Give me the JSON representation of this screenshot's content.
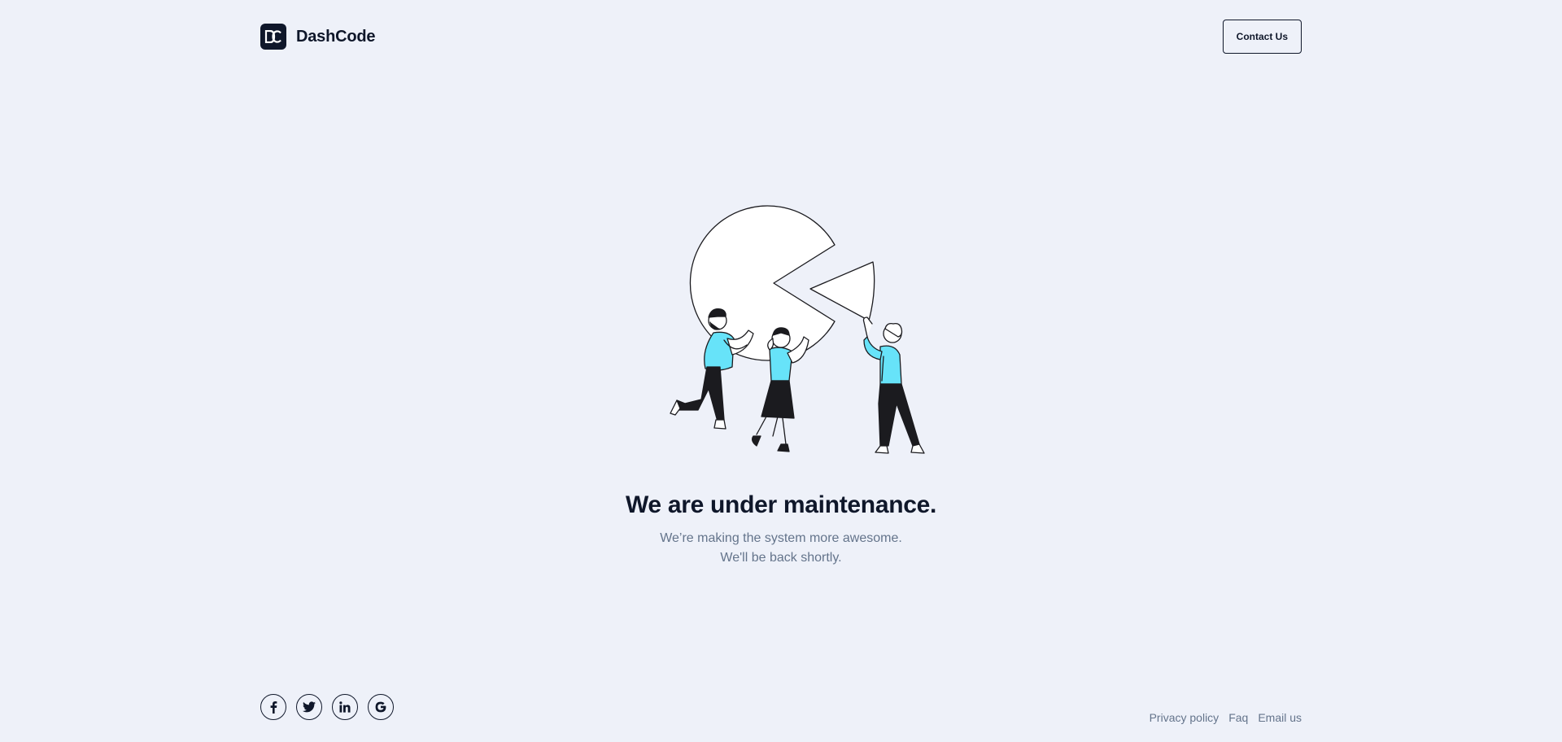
{
  "header": {
    "brand_name": "DashCode",
    "logo_letters": "DC",
    "contact_label": "Contact Us"
  },
  "main": {
    "title": "We are under maintenance.",
    "subtitle_line1": "We’re making the system more awesome.",
    "subtitle_line2": "We'll be back shortly."
  },
  "footer": {
    "socials": [
      "facebook-icon",
      "twitter-icon",
      "linkedin-icon",
      "google-icon"
    ],
    "links": [
      "Privacy policy",
      "Faq",
      "Email us"
    ]
  },
  "colors": {
    "background": "#eef1f9",
    "text_dark": "#0f172a",
    "text_muted": "#64748b",
    "accent_cyan": "#67e3f9"
  }
}
